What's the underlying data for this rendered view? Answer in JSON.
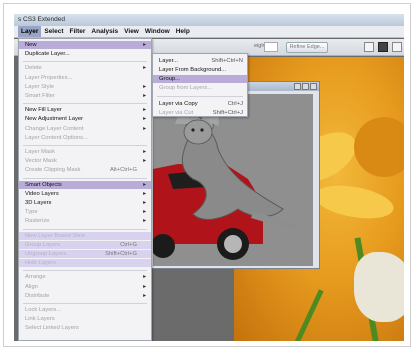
{
  "app": {
    "title": "s CS3 Extended"
  },
  "menubar": [
    "Layer",
    "Select",
    "Filter",
    "Analysis",
    "View",
    "Window",
    "Help"
  ],
  "optbar": {
    "height_label": "eight:",
    "refine_label": "Refine Edge..."
  },
  "layer_menu": [
    {
      "label": "New",
      "arrow": "▸",
      "state": "highlight"
    },
    {
      "label": "Duplicate Layer...",
      "state": "normal"
    },
    {
      "label": "Delete",
      "arrow": "▸",
      "state": "disabled"
    },
    {
      "label": "Layer Properties...",
      "state": "disabled"
    },
    {
      "label": "Layer Style",
      "arrow": "▸",
      "state": "disabled"
    },
    {
      "label": "Smart Filter",
      "arrow": "▸",
      "state": "disabled"
    },
    {
      "label": "New Fill Layer",
      "arrow": "▸",
      "state": "normal"
    },
    {
      "label": "New Adjustment Layer",
      "arrow": "▸",
      "state": "normal"
    },
    {
      "label": "Change Layer Content",
      "arrow": "▸",
      "state": "disabled"
    },
    {
      "label": "Layer Content Options...",
      "state": "disabled"
    },
    {
      "label": "Layer Mask",
      "arrow": "▸",
      "state": "disabled"
    },
    {
      "label": "Vector Mask",
      "arrow": "▸",
      "state": "disabled"
    },
    {
      "label": "Create Clipping Mask",
      "shortcut": "Alt+Ctrl+G",
      "state": "disabled"
    },
    {
      "label": "Smart Objects",
      "arrow": "▸",
      "state": "highlight"
    },
    {
      "label": "Video Layers",
      "arrow": "▸",
      "state": "normal"
    },
    {
      "label": "3D Layers",
      "arrow": "▸",
      "state": "normal"
    },
    {
      "label": "Type",
      "arrow": "▸",
      "state": "disabled"
    },
    {
      "label": "Rasterize",
      "arrow": "▸",
      "state": "disabled"
    },
    {
      "label": "New Layer Based Slice",
      "state": "faint"
    },
    {
      "label": "Group Layers",
      "shortcut": "Ctrl+G",
      "state": "faint"
    },
    {
      "label": "Ungroup Layers",
      "shortcut": "Shift+Ctrl+G",
      "state": "faint"
    },
    {
      "label": "Hide Layers",
      "state": "faint"
    },
    {
      "label": "Arrange",
      "arrow": "▸",
      "state": "disabled"
    },
    {
      "label": "Align",
      "arrow": "▸",
      "state": "disabled"
    },
    {
      "label": "Distribute",
      "arrow": "▸",
      "state": "disabled"
    },
    {
      "label": "Lock Layers...",
      "state": "disabled"
    },
    {
      "label": "Link Layers",
      "state": "disabled"
    },
    {
      "label": "Select Linked Layers",
      "state": "disabled"
    }
  ],
  "submenu": [
    {
      "label": "Layer...",
      "shortcut": "Shift+Ctrl+N",
      "state": "normal"
    },
    {
      "label": "Layer From Background...",
      "state": "normal"
    },
    {
      "label": "Group...",
      "state": "highlight"
    },
    {
      "label": "Group from Layers...",
      "state": "disabled"
    },
    {
      "label": "Layer via Copy",
      "shortcut": "Ctrl+J",
      "state": "normal"
    },
    {
      "label": "Layer via Cut",
      "shortcut": "Shift+Ctrl+J",
      "state": "disabled"
    }
  ]
}
